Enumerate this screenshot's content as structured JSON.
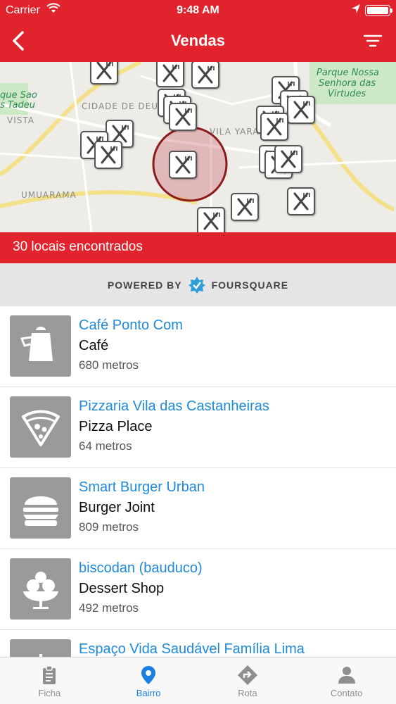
{
  "status": {
    "carrier": "Carrier",
    "time": "9:48 AM"
  },
  "nav": {
    "title": "Vendas"
  },
  "map": {
    "labels": {
      "cidade_de_deus": "CIDADE DE DEUS",
      "vila_yara": "VILA YARA",
      "umuarama": "UMUARAMA",
      "vista": "VISTA",
      "parque_line1": "Parque Nossa",
      "parque_line2": "Senhora das",
      "parque_line3": "Virtudes",
      "sao_line1": "que Sao",
      "sao_line2": "s Tadeu"
    }
  },
  "results_count": "30 locais encontrados",
  "powered_by": {
    "prefix": "POWERED BY",
    "brand": "FOURSQUARE"
  },
  "places": [
    {
      "name": "Café Ponto Com",
      "category": "Café",
      "distance": "680 metros",
      "icon": "coffee-pot-icon"
    },
    {
      "name": "Pizzaria Vila das Castanheiras",
      "category": "Pizza Place",
      "distance": "64 metros",
      "icon": "pizza-slice-icon"
    },
    {
      "name": "Smart Burger Urban",
      "category": "Burger Joint",
      "distance": "809 metros",
      "icon": "burger-icon"
    },
    {
      "name": "biscodan (bauduco)",
      "category": "Dessert Shop",
      "distance": "492 metros",
      "icon": "ice-cream-icon"
    },
    {
      "name": "Espaço Vida Saudável Família Lima",
      "category": "",
      "distance": "",
      "icon": "salad-icon"
    }
  ],
  "tabs": [
    {
      "label": "Ficha",
      "icon": "clipboard-icon",
      "active": false
    },
    {
      "label": "Bairro",
      "icon": "map-pin-icon",
      "active": true
    },
    {
      "label": "Rota",
      "icon": "directions-icon",
      "active": false
    },
    {
      "label": "Contato",
      "icon": "person-icon",
      "active": false
    }
  ],
  "colors": {
    "brand_red": "#e0232d",
    "link_blue": "#1f8ad6",
    "active_tab": "#1a7fe0"
  }
}
